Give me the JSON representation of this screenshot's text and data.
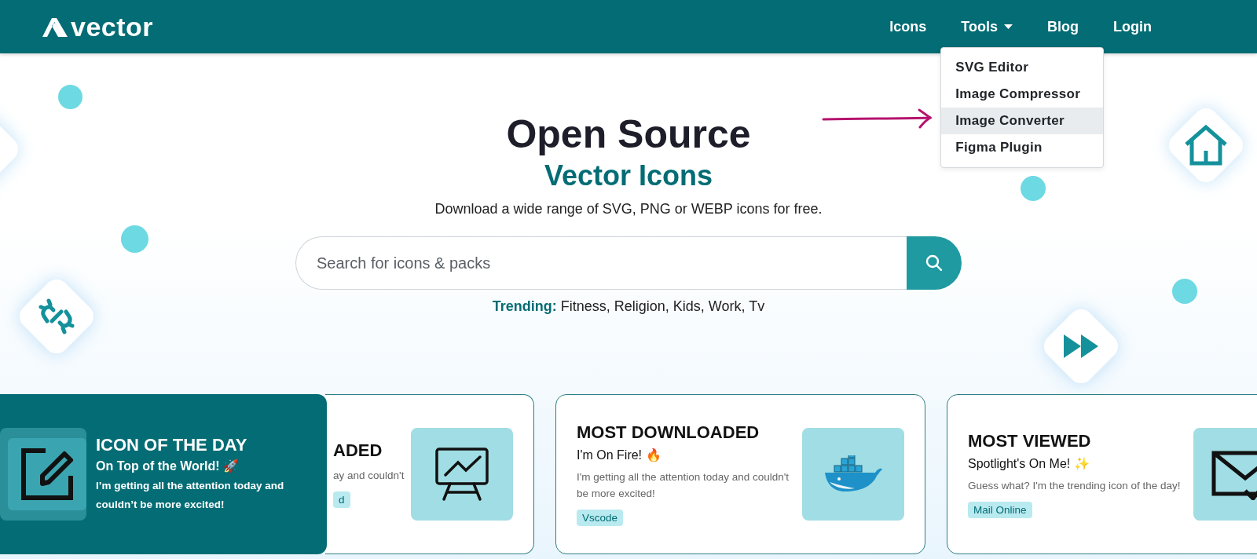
{
  "header": {
    "logo": "vector",
    "nav": [
      {
        "label": "Icons",
        "kind": "link"
      },
      {
        "label": "Tools",
        "kind": "dropdown",
        "expanded": true
      },
      {
        "label": "Blog",
        "kind": "link"
      },
      {
        "label": "Login",
        "kind": "link"
      }
    ]
  },
  "dropdown": {
    "items": [
      {
        "label": "SVG Editor",
        "selected": false
      },
      {
        "label": "Image Compressor",
        "selected": false
      },
      {
        "label": "Image Converter",
        "selected": true
      },
      {
        "label": "Figma Plugin",
        "selected": false
      }
    ]
  },
  "hero": {
    "title": "Open Source",
    "subtitle": "Vector Icons",
    "description": "Download a wide range of SVG, PNG or WEBP icons for free.",
    "search": {
      "placeholder": "Search for icons & packs"
    },
    "trending": "**Trending:** Fitness, Religion, Kids, Work, Tv"
  },
  "cards": [
    {
      "kind": "featured",
      "title": "ICON OF THE DAY",
      "subtitle": "On Top of the World! 🚀",
      "description": "I’m getting all the attention today and couldn’t be more excited!"
    },
    {
      "kind": "partial",
      "title": "ADED",
      "description": "ay and couldn't",
      "tag": "d"
    },
    {
      "kind": "standard",
      "title": "MOST DOWNLOADED",
      "subtitle": "I'm On Fire! 🔥",
      "description": "I'm getting all the attention today and couldn't be more excited!",
      "tag": "Vscode"
    },
    {
      "kind": "standard",
      "title": "MOST VIEWED",
      "subtitle": "Spotlight's On Me! ✨",
      "description": "Guess what? I'm the trending icon of the day!",
      "tag": "Mail Online"
    }
  ]
}
